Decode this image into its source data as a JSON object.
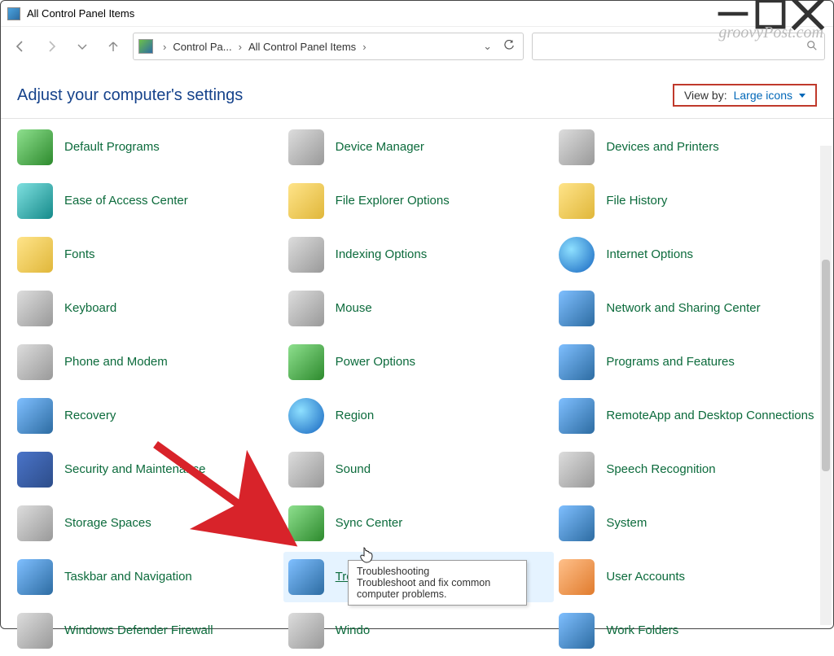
{
  "window": {
    "title": "All Control Panel Items"
  },
  "watermark": "groovyPost.com",
  "breadcrumbs": {
    "root": "Control Pa...",
    "current": "All Control Panel Items"
  },
  "header": {
    "heading": "Adjust your computer's settings",
    "viewby_label": "View by:",
    "viewby_value": "Large icons"
  },
  "items": [
    {
      "label": "Default Programs",
      "icon": "ic-green"
    },
    {
      "label": "Device Manager",
      "icon": "ic-gray"
    },
    {
      "label": "Devices and Printers",
      "icon": "ic-gray"
    },
    {
      "label": "Ease of Access Center",
      "icon": "ic-teal"
    },
    {
      "label": "File Explorer Options",
      "icon": "ic-yellow"
    },
    {
      "label": "File History",
      "icon": "ic-yellow"
    },
    {
      "label": "Fonts",
      "icon": "ic-yellow"
    },
    {
      "label": "Indexing Options",
      "icon": "ic-gray"
    },
    {
      "label": "Internet Options",
      "icon": "ic-globe"
    },
    {
      "label": "Keyboard",
      "icon": "ic-gray"
    },
    {
      "label": "Mouse",
      "icon": "ic-gray"
    },
    {
      "label": "Network and Sharing Center",
      "icon": "ic-blue"
    },
    {
      "label": "Phone and Modem",
      "icon": "ic-gray"
    },
    {
      "label": "Power Options",
      "icon": "ic-green"
    },
    {
      "label": "Programs and Features",
      "icon": "ic-blue"
    },
    {
      "label": "Recovery",
      "icon": "ic-blue"
    },
    {
      "label": "Region",
      "icon": "ic-globe"
    },
    {
      "label": "RemoteApp and Desktop Connections",
      "icon": "ic-blue"
    },
    {
      "label": "Security and Maintenance",
      "icon": "ic-flag"
    },
    {
      "label": "Sound",
      "icon": "ic-gray"
    },
    {
      "label": "Speech Recognition",
      "icon": "ic-gray"
    },
    {
      "label": "Storage Spaces",
      "icon": "ic-gray"
    },
    {
      "label": "Sync Center",
      "icon": "ic-green"
    },
    {
      "label": "System",
      "icon": "ic-blue"
    },
    {
      "label": "Taskbar and Navigation",
      "icon": "ic-blue"
    },
    {
      "label": "Troubleshooting",
      "icon": "ic-blue",
      "highlight": true
    },
    {
      "label": "User Accounts",
      "icon": "ic-orange"
    },
    {
      "label": "Windows Defender Firewall",
      "icon": "ic-gray"
    },
    {
      "label": "Windo",
      "icon": "ic-gray"
    },
    {
      "label": "Work Folders",
      "icon": "ic-blue"
    }
  ],
  "tooltip": {
    "title": "Troubleshooting",
    "body": "Troubleshoot and fix common computer problems."
  }
}
